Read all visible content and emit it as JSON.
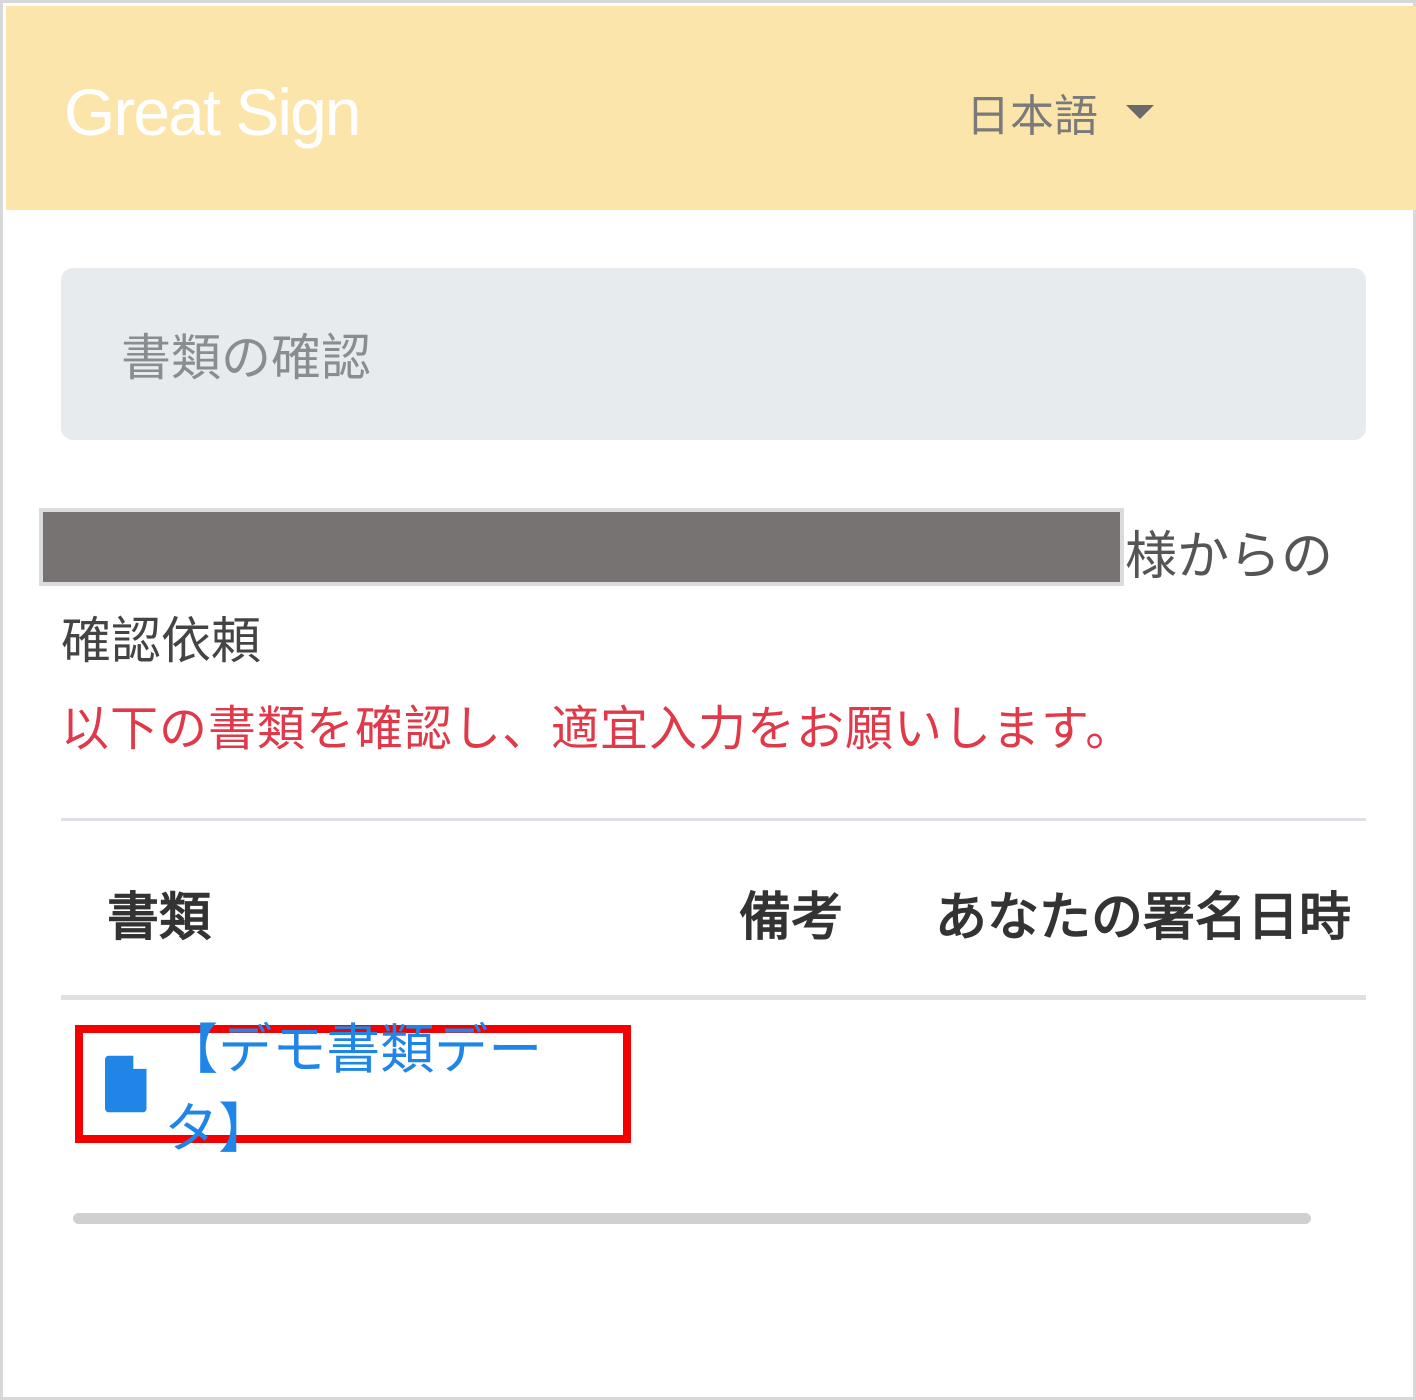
{
  "header": {
    "brand": "Great Sign",
    "language": "日本語"
  },
  "breadcrumb": {
    "title": "書類の確認"
  },
  "request": {
    "sender_suffix": "様からの",
    "title": "確認依頼",
    "message": "以下の書類を確認し、適宜入力をお願いします。"
  },
  "table": {
    "columns": [
      "書類",
      "備考",
      "あなたの署名日時"
    ],
    "rows": [
      {
        "document": "【デモ書類データ】",
        "icon": "file-icon"
      }
    ]
  },
  "colors": {
    "navbar": "#fbe5aa",
    "link": "#1f86e8",
    "message": "#e0394a",
    "highlight": "#f50000"
  }
}
